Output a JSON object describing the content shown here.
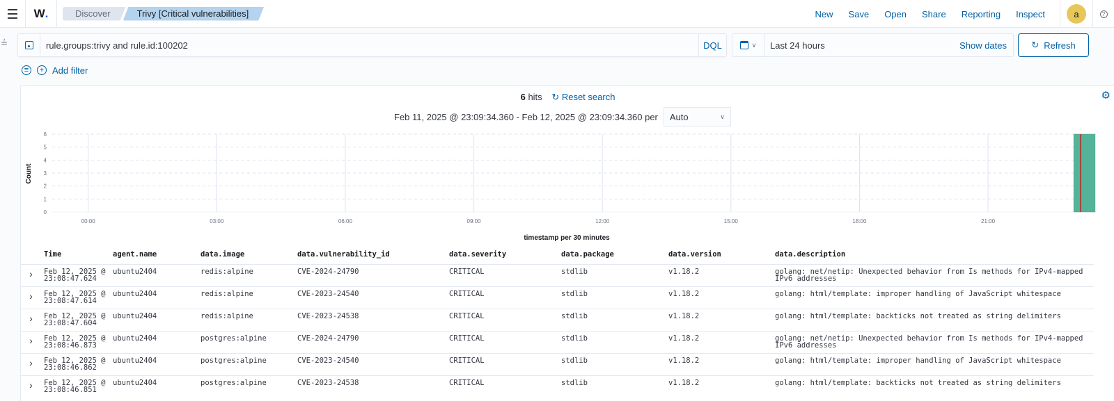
{
  "topbar": {
    "logo": "W",
    "breadcrumbs": [
      "Discover",
      "Trivy [Critical vulnerabilities]"
    ],
    "nav": [
      "New",
      "Save",
      "Open",
      "Share",
      "Reporting",
      "Inspect"
    ],
    "avatar_initial": "a",
    "help_glyph": "?"
  },
  "query": {
    "value": "rule.groups:trivy and rule.id:100202",
    "language": "DQL"
  },
  "datepicker": {
    "range": "Last 24 hours",
    "show_dates": "Show dates",
    "refresh": "Refresh"
  },
  "filters": {
    "add_filter": "Add filter"
  },
  "summary": {
    "hits_count": "6",
    "hits_label": "hits",
    "reset_search": "Reset search",
    "interval_text": "Feb 11, 2025 @ 23:09:34.360 - Feb 12, 2025 @ 23:09:34.360 per",
    "interval_value": "Auto"
  },
  "chart_data": {
    "type": "bar",
    "title": "",
    "xlabel": "timestamp per 30 minutes",
    "ylabel": "Count",
    "ylim": [
      0,
      6
    ],
    "yticks": [
      0,
      1,
      2,
      3,
      4,
      5,
      6
    ],
    "x_domain_hours": [
      -0.84,
      23.16
    ],
    "xticks": [
      {
        "label": "00:00",
        "hour": 0
      },
      {
        "label": "03:00",
        "hour": 3
      },
      {
        "label": "06:00",
        "hour": 6
      },
      {
        "label": "09:00",
        "hour": 9
      },
      {
        "label": "12:00",
        "hour": 12
      },
      {
        "label": "15:00",
        "hour": 15
      },
      {
        "label": "18:00",
        "hour": 18
      },
      {
        "label": "21:00",
        "hour": 21
      }
    ],
    "bucket_minutes": 30,
    "bars": [
      {
        "start_hour": 23.0,
        "end_hour": 23.5,
        "value": 6
      }
    ],
    "now_marker_hour": 23.16,
    "grid": true,
    "colors": {
      "bar": "#54b399",
      "now": "#bd271e"
    }
  },
  "table": {
    "columns": [
      "Time",
      "agent.name",
      "data.image",
      "data.vulnerability_id",
      "data.severity",
      "data.package",
      "data.version",
      "data.description"
    ],
    "rows": [
      {
        "time_date": "Feb 12, 2025 @",
        "time_clock": "23:08:47.624",
        "agent": "ubuntu2404",
        "image": "redis:alpine",
        "vuln": "CVE-2024-24790",
        "severity": "CRITICAL",
        "package": "stdlib",
        "version": "v1.18.2",
        "description": "golang: net/netip: Unexpected behavior from Is methods for IPv4-mapped IPv6 addresses"
      },
      {
        "time_date": "Feb 12, 2025 @",
        "time_clock": "23:08:47.614",
        "agent": "ubuntu2404",
        "image": "redis:alpine",
        "vuln": "CVE-2023-24540",
        "severity": "CRITICAL",
        "package": "stdlib",
        "version": "v1.18.2",
        "description": "golang: html/template: improper handling of JavaScript whitespace"
      },
      {
        "time_date": "Feb 12, 2025 @",
        "time_clock": "23:08:47.604",
        "agent": "ubuntu2404",
        "image": "redis:alpine",
        "vuln": "CVE-2023-24538",
        "severity": "CRITICAL",
        "package": "stdlib",
        "version": "v1.18.2",
        "description": "golang: html/template: backticks not treated as string delimiters"
      },
      {
        "time_date": "Feb 12, 2025 @",
        "time_clock": "23:08:46.873",
        "agent": "ubuntu2404",
        "image": "postgres:alpine",
        "vuln": "CVE-2024-24790",
        "severity": "CRITICAL",
        "package": "stdlib",
        "version": "v1.18.2",
        "description": "golang: net/netip: Unexpected behavior from Is methods for IPv4-mapped IPv6 addresses"
      },
      {
        "time_date": "Feb 12, 2025 @",
        "time_clock": "23:08:46.862",
        "agent": "ubuntu2404",
        "image": "postgres:alpine",
        "vuln": "CVE-2023-24540",
        "severity": "CRITICAL",
        "package": "stdlib",
        "version": "v1.18.2",
        "description": "golang: html/template: improper handling of JavaScript whitespace"
      },
      {
        "time_date": "Feb 12, 2025 @",
        "time_clock": "23:08:46.851",
        "agent": "ubuntu2404",
        "image": "postgres:alpine",
        "vuln": "CVE-2023-24538",
        "severity": "CRITICAL",
        "package": "stdlib",
        "version": "v1.18.2",
        "description": "golang: html/template: backticks not treated as string delimiters"
      }
    ]
  }
}
